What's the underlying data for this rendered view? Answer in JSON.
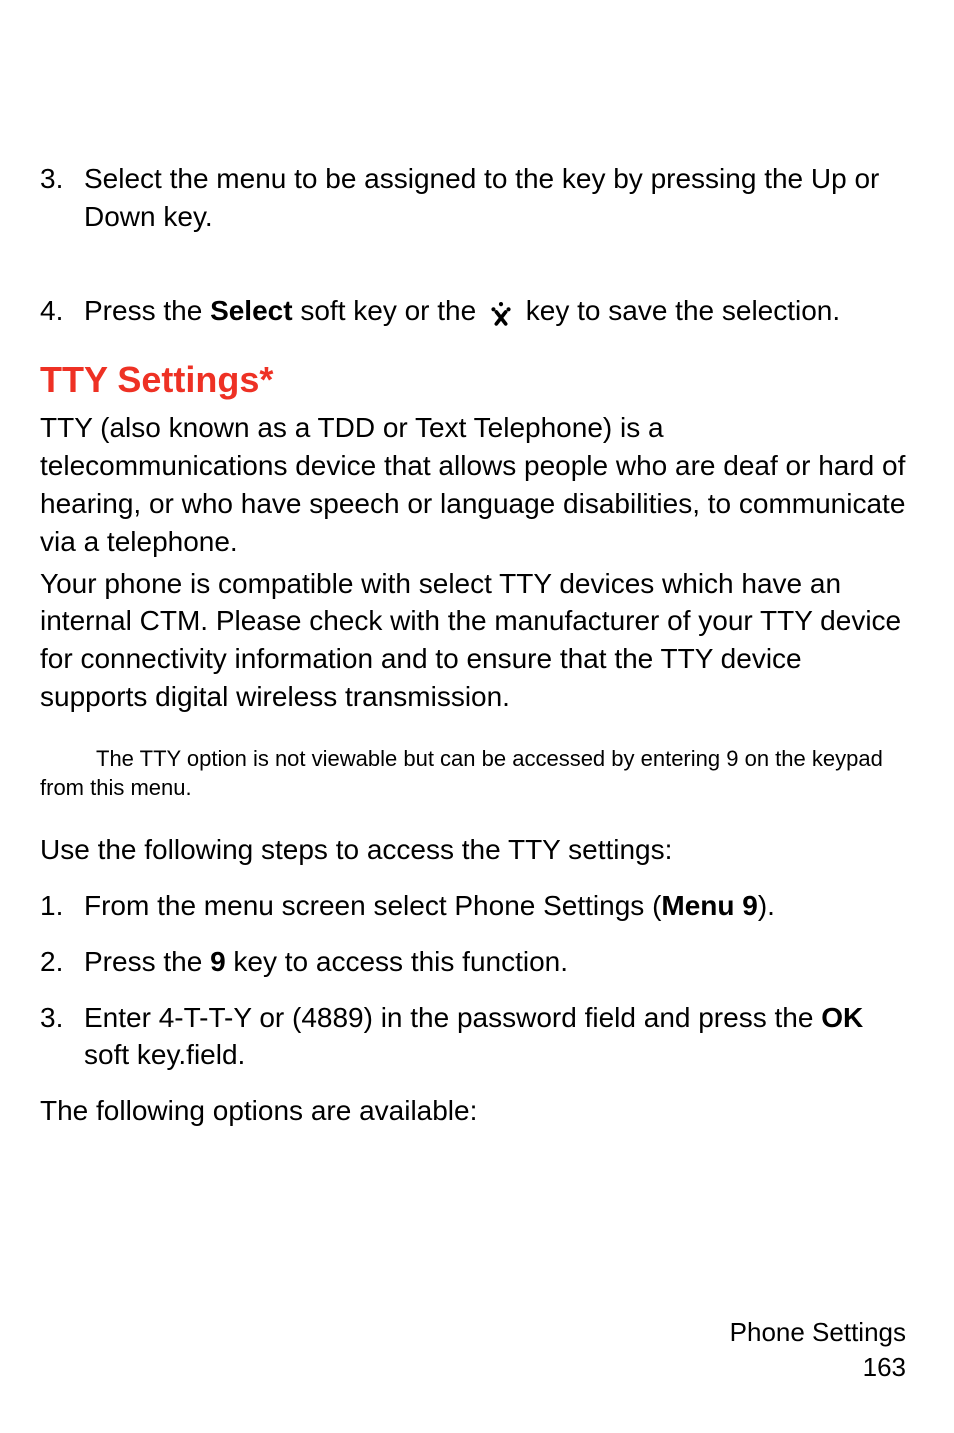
{
  "steps_top": [
    {
      "num": "3.",
      "text_parts": [
        "Select the menu to be assigned to the key by pressing the Up or Down key."
      ]
    },
    {
      "num": "4.",
      "text_parts": [
        "Press the ",
        {
          "bold": true,
          "text": "Select"
        },
        " soft key or the ",
        {
          "icon": true
        },
        " key to save the selection."
      ]
    }
  ],
  "heading": {
    "text": "TTY Settings*",
    "color": "#ee3124"
  },
  "body_paragraphs": [
    "TTY (also known as a TDD or Text Telephone) is a telecommunications device that allows people who are deaf or hard of hearing, or who have speech or language disabilities, to communicate via a telephone.",
    "Your phone is compatible with select TTY devices which have an internal CTM. Please check with the manufacturer of your TTY device for connectivity information and to ensure that the TTY device supports digital wireless transmission."
  ],
  "note": "The TTY option is not viewable but can be accessed by entering 9 on the keypad from this menu.",
  "intro_steps": "Use the following steps to access the TTY settings:",
  "steps_bottom": [
    {
      "num": "1.",
      "text_parts": [
        "From  the menu screen select Phone Settings (",
        {
          "bold": true,
          "text": "Menu 9"
        },
        ")."
      ]
    },
    {
      "num": "2.",
      "text_parts": [
        "Press the ",
        {
          "bold": true,
          "text": "9"
        },
        " key to access this function."
      ]
    },
    {
      "num": "3.",
      "text_parts": [
        "Enter 4-T-T-Y or (4889) in the password field and press the ",
        {
          "bold": true,
          "text": "OK"
        },
        " soft key.field."
      ]
    }
  ],
  "closing": "The following options are available:",
  "footer": {
    "section": "Phone Settings",
    "page": "163"
  }
}
